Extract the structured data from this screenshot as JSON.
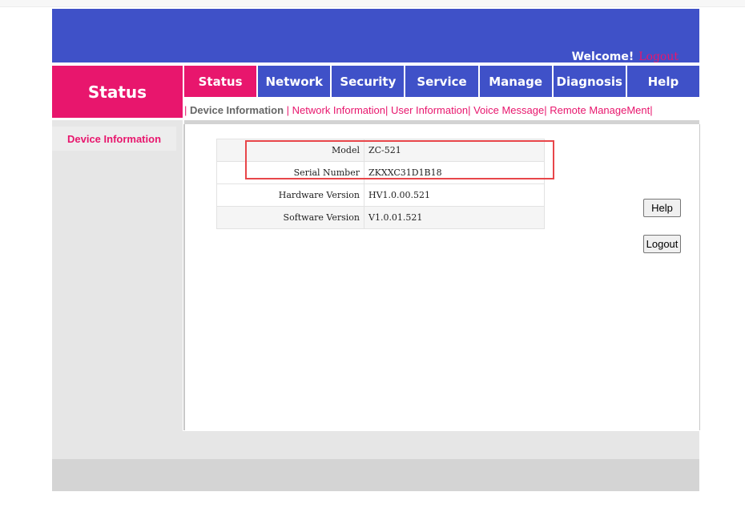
{
  "header": {
    "welcome_text": "Welcome!",
    "logout_link": "Logout"
  },
  "section_title": "Status",
  "tabs": [
    {
      "label": "Status",
      "active": true
    },
    {
      "label": "Network"
    },
    {
      "label": "Security"
    },
    {
      "label": "Service"
    },
    {
      "label": "Manage"
    },
    {
      "label": "Diagnosis"
    },
    {
      "label": "Help"
    }
  ],
  "subnav": [
    {
      "label": "Device Information",
      "active": true
    },
    {
      "label": "Network Information"
    },
    {
      "label": "User Information"
    },
    {
      "label": "Voice Message"
    },
    {
      "label": "Remote ManageMent"
    }
  ],
  "sidebar": {
    "items": [
      {
        "label": "Device Information"
      }
    ]
  },
  "device_info": {
    "rows": [
      {
        "key": "Model",
        "value": "ZC-521"
      },
      {
        "key": "Serial Number",
        "value": "ZKXXC31D1B18"
      },
      {
        "key": "Hardware Version",
        "value": "HV1.0.00.521"
      },
      {
        "key": "Software Version",
        "value": "V1.0.01.521"
      }
    ]
  },
  "buttons": {
    "help": "Help",
    "logout": "Logout"
  },
  "colors": {
    "primary_blue": "#3f51c8",
    "accent_pink": "#e8166d",
    "highlight_red": "#e8464a"
  }
}
